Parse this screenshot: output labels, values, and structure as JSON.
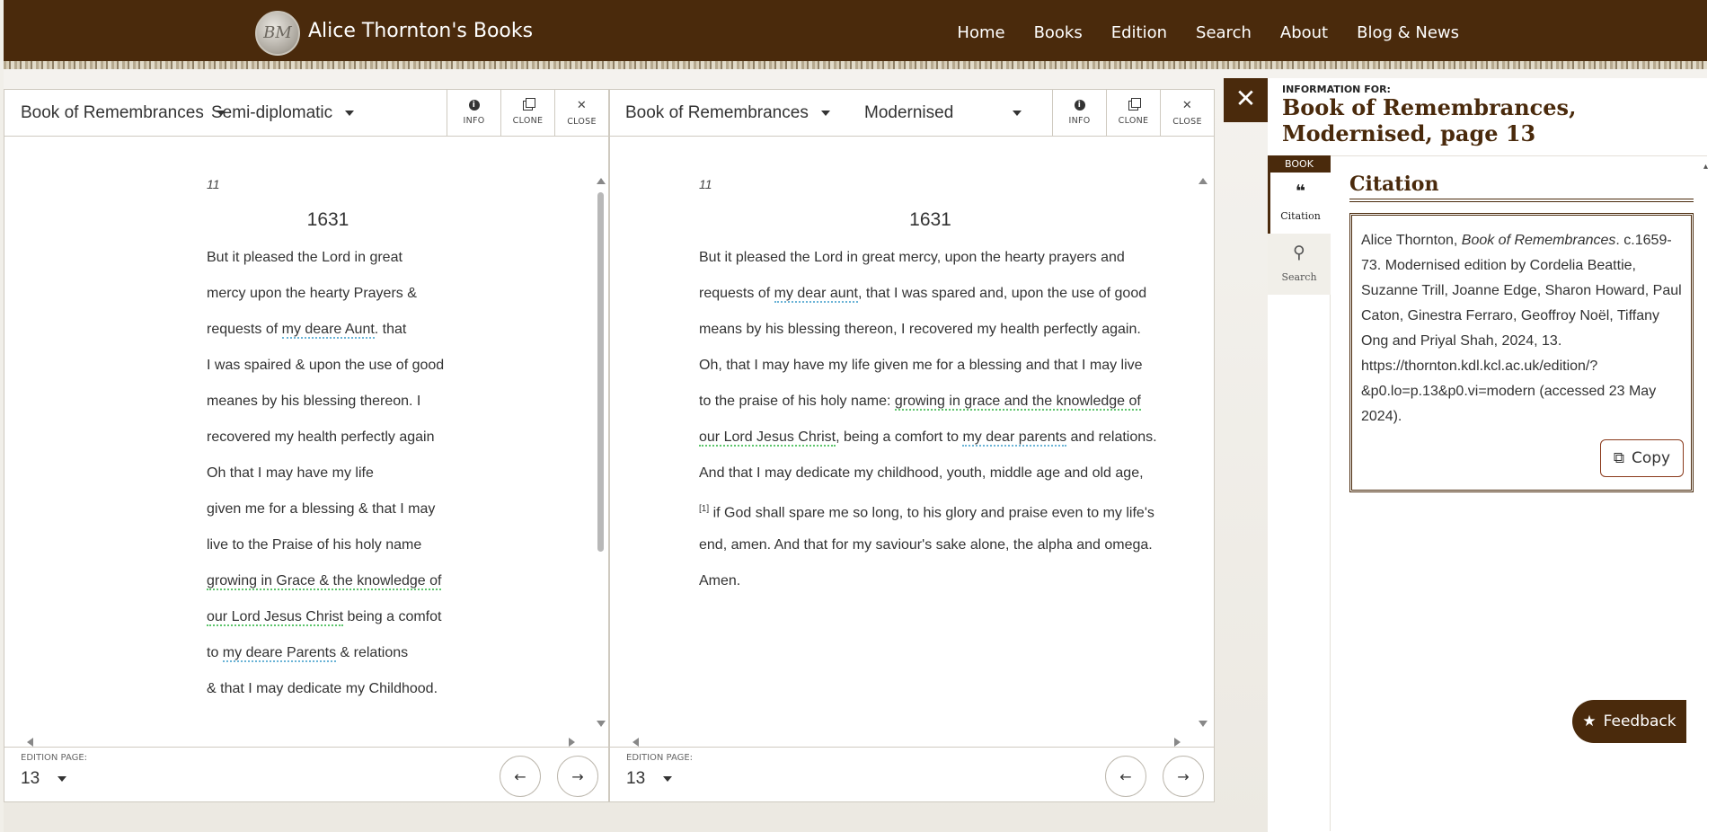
{
  "header": {
    "logo_text": "BM",
    "site_title": "Alice Thornton's Books",
    "nav": [
      "Home",
      "Books",
      "Edition",
      "Search",
      "About",
      "Blog & News"
    ]
  },
  "colors": {
    "brand_brown": "#4a2a0c",
    "person_underline": "#6ab3d6",
    "grace_underline": "#5cc56b"
  },
  "panels": [
    {
      "book": "Book of Remembrances",
      "view": "Semi-diplomatic",
      "buttons": {
        "info": "INFO",
        "clone": "CLONE",
        "close": "CLOSE"
      },
      "page_number": "11",
      "year": "1631",
      "lines": [
        [
          {
            "t": "But it pleased the Lord in great"
          }
        ],
        [
          {
            "t": "mercy upon the hearty Prayers &"
          }
        ],
        [
          {
            "t": "requests of "
          },
          {
            "t": "my deare Aunt",
            "c": "ppl"
          },
          {
            "t": ". that"
          }
        ],
        [
          {
            "t": "I was spaired & upon the use of good"
          }
        ],
        [
          {
            "t": "meanes by his blessing thereon. I"
          }
        ],
        [
          {
            "t": "recovered my health perfectly again"
          }
        ],
        [
          {
            "t": "Oh that I may have my life"
          }
        ],
        [
          {
            "t": "given me for a blessing & that I may"
          }
        ],
        [
          {
            "t": "live to the Praise of his holy name"
          }
        ],
        [
          {
            "t": "growing in Grace & the knowledge of",
            "c": "grc"
          }
        ],
        [
          {
            "t": "our Lord Jesus Christ",
            "c": "grc"
          },
          {
            "t": " being a comfot"
          }
        ],
        [
          {
            "t": "to "
          },
          {
            "t": "my deare Parents",
            "c": "ppl"
          },
          {
            "t": " & relations"
          }
        ],
        [
          {
            "t": "& that I may dedicate my Childhood."
          }
        ]
      ],
      "footer": {
        "label": "EDITION PAGE:",
        "page": "13"
      }
    },
    {
      "book": "Book of Remembrances",
      "view": "Modernised",
      "buttons": {
        "info": "INFO",
        "clone": "CLONE",
        "close": "CLOSE"
      },
      "page_number": "11",
      "year": "1631",
      "lines": [
        [
          {
            "t": "But it pleased the Lord in great mercy, upon the hearty prayers and"
          }
        ],
        [
          {
            "t": "requests of "
          },
          {
            "t": "my dear aunt",
            "c": "ppl"
          },
          {
            "t": ", that I was spared and, upon the use of good"
          }
        ],
        [
          {
            "t": "means by his blessing thereon, I recovered my health perfectly again."
          }
        ],
        [
          {
            "t": "Oh, that I may have my life given me for a blessing and that I may live"
          }
        ],
        [
          {
            "t": "to the praise of his holy name: "
          },
          {
            "t": "growing in grace and the knowledge of",
            "c": "grc"
          }
        ],
        [
          {
            "t": "our Lord Jesus Christ",
            "c": "grc"
          },
          {
            "t": ", being a comfort to "
          },
          {
            "t": "my dear parents",
            "c": "ppl"
          },
          {
            "t": " and relations."
          }
        ],
        [
          {
            "t": "And that I may dedicate my childhood, youth, middle age and old age,"
          }
        ],
        [
          {
            "t": "[1]",
            "sup": true
          },
          {
            "t": " if God shall spare me so long, to his glory and praise even to my life's"
          }
        ],
        [
          {
            "t": "end, amen. And that for my saviour's sake alone, the alpha and omega."
          }
        ],
        [
          {
            "t": "Amen."
          }
        ]
      ],
      "footer": {
        "label": "EDITION PAGE:",
        "page": "13"
      }
    }
  ],
  "info_panel": {
    "info_for": "INFORMATION FOR:",
    "title": "Book of Remembrances, Modernised, page 13",
    "side_head": "BOOK",
    "tabs": [
      {
        "label": "Citation",
        "icon": "quote-icon"
      },
      {
        "label": "Search",
        "icon": "search-icon"
      }
    ],
    "citation_heading": "Citation",
    "citation": {
      "author": "Alice Thornton, ",
      "work": "Book of Remembrances",
      "rest": ". c.1659-73. Modernised edition by Cordelia Beattie, Suzanne Trill, Joanne Edge, Sharon Howard, Paul Caton, Ginestra Ferraro, Geoffroy Noël, Tiffany Ong and Priyal Shah, 2024, 13. https://thornton.kdl.kcl.ac.uk/edition/?&p0.lo=p.13&p0.vi=modern (accessed 23 May 2024)."
    },
    "copy_label": "Copy"
  },
  "feedback_label": "Feedback"
}
